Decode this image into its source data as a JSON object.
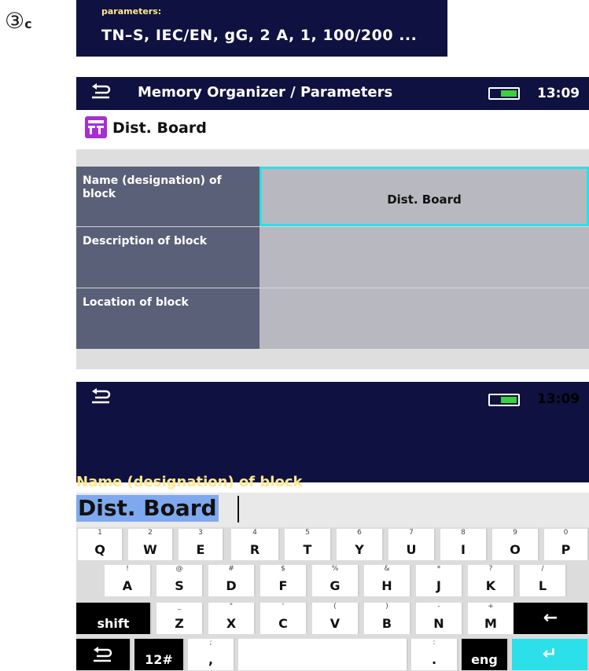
{
  "step_label": "③",
  "step_suffix": "c",
  "params_box": {
    "label": "parameters:",
    "value": "TN–S, IEC/EN, gG, 2 A, 1, 100/200 ..."
  },
  "screen1": {
    "title": "Memory Organizer / Parameters",
    "time": "13:09",
    "breadcrumb": "Dist. Board",
    "rows": [
      {
        "label": "Name (designation) of block",
        "value": "Dist. Board"
      },
      {
        "label": "Description of block",
        "value": ""
      },
      {
        "label": "Location of block",
        "value": ""
      }
    ]
  },
  "screen2": {
    "time": "13:09",
    "prompt": "Name (designation) of block",
    "input_value": "Dist. Board"
  },
  "keyboard": {
    "row1": [
      {
        "main": "Q",
        "sub": "1"
      },
      {
        "main": "W",
        "sub": "2"
      },
      {
        "main": "E",
        "sub": "3"
      },
      {
        "main": "R",
        "sub": "4"
      },
      {
        "main": "T",
        "sub": "5"
      },
      {
        "main": "Y",
        "sub": "6"
      },
      {
        "main": "U",
        "sub": "7"
      },
      {
        "main": "I",
        "sub": "8"
      },
      {
        "main": "O",
        "sub": "9"
      },
      {
        "main": "P",
        "sub": "0"
      }
    ],
    "row2": [
      {
        "main": "A",
        "sub": "!"
      },
      {
        "main": "S",
        "sub": "@"
      },
      {
        "main": "D",
        "sub": "#"
      },
      {
        "main": "F",
        "sub": "$"
      },
      {
        "main": "G",
        "sub": "%"
      },
      {
        "main": "H",
        "sub": "&"
      },
      {
        "main": "J",
        "sub": "*"
      },
      {
        "main": "K",
        "sub": "?"
      },
      {
        "main": "L",
        "sub": "/"
      }
    ],
    "row3": [
      {
        "main": "Z",
        "sub": "_"
      },
      {
        "main": "X",
        "sub": "\""
      },
      {
        "main": "C",
        "sub": "'"
      },
      {
        "main": "V",
        "sub": "("
      },
      {
        "main": "B",
        "sub": ")"
      },
      {
        "main": "N",
        "sub": "-"
      },
      {
        "main": "M",
        "sub": "+"
      }
    ],
    "shift_label": "shift",
    "backspace_icon": "←",
    "numsym_label": "12#",
    "comma_main": ",",
    "comma_sub": ";",
    "period_main": ".",
    "period_sub": ":",
    "lang_label": "eng",
    "enter_icon": "↵"
  },
  "colors": {
    "header_bg": "#0f1240",
    "accent_cyan": "#2be0e8",
    "prompt_yellow": "#ffe98a",
    "label_cell": "#5a6077",
    "value_cell": "#b8b9c0"
  }
}
